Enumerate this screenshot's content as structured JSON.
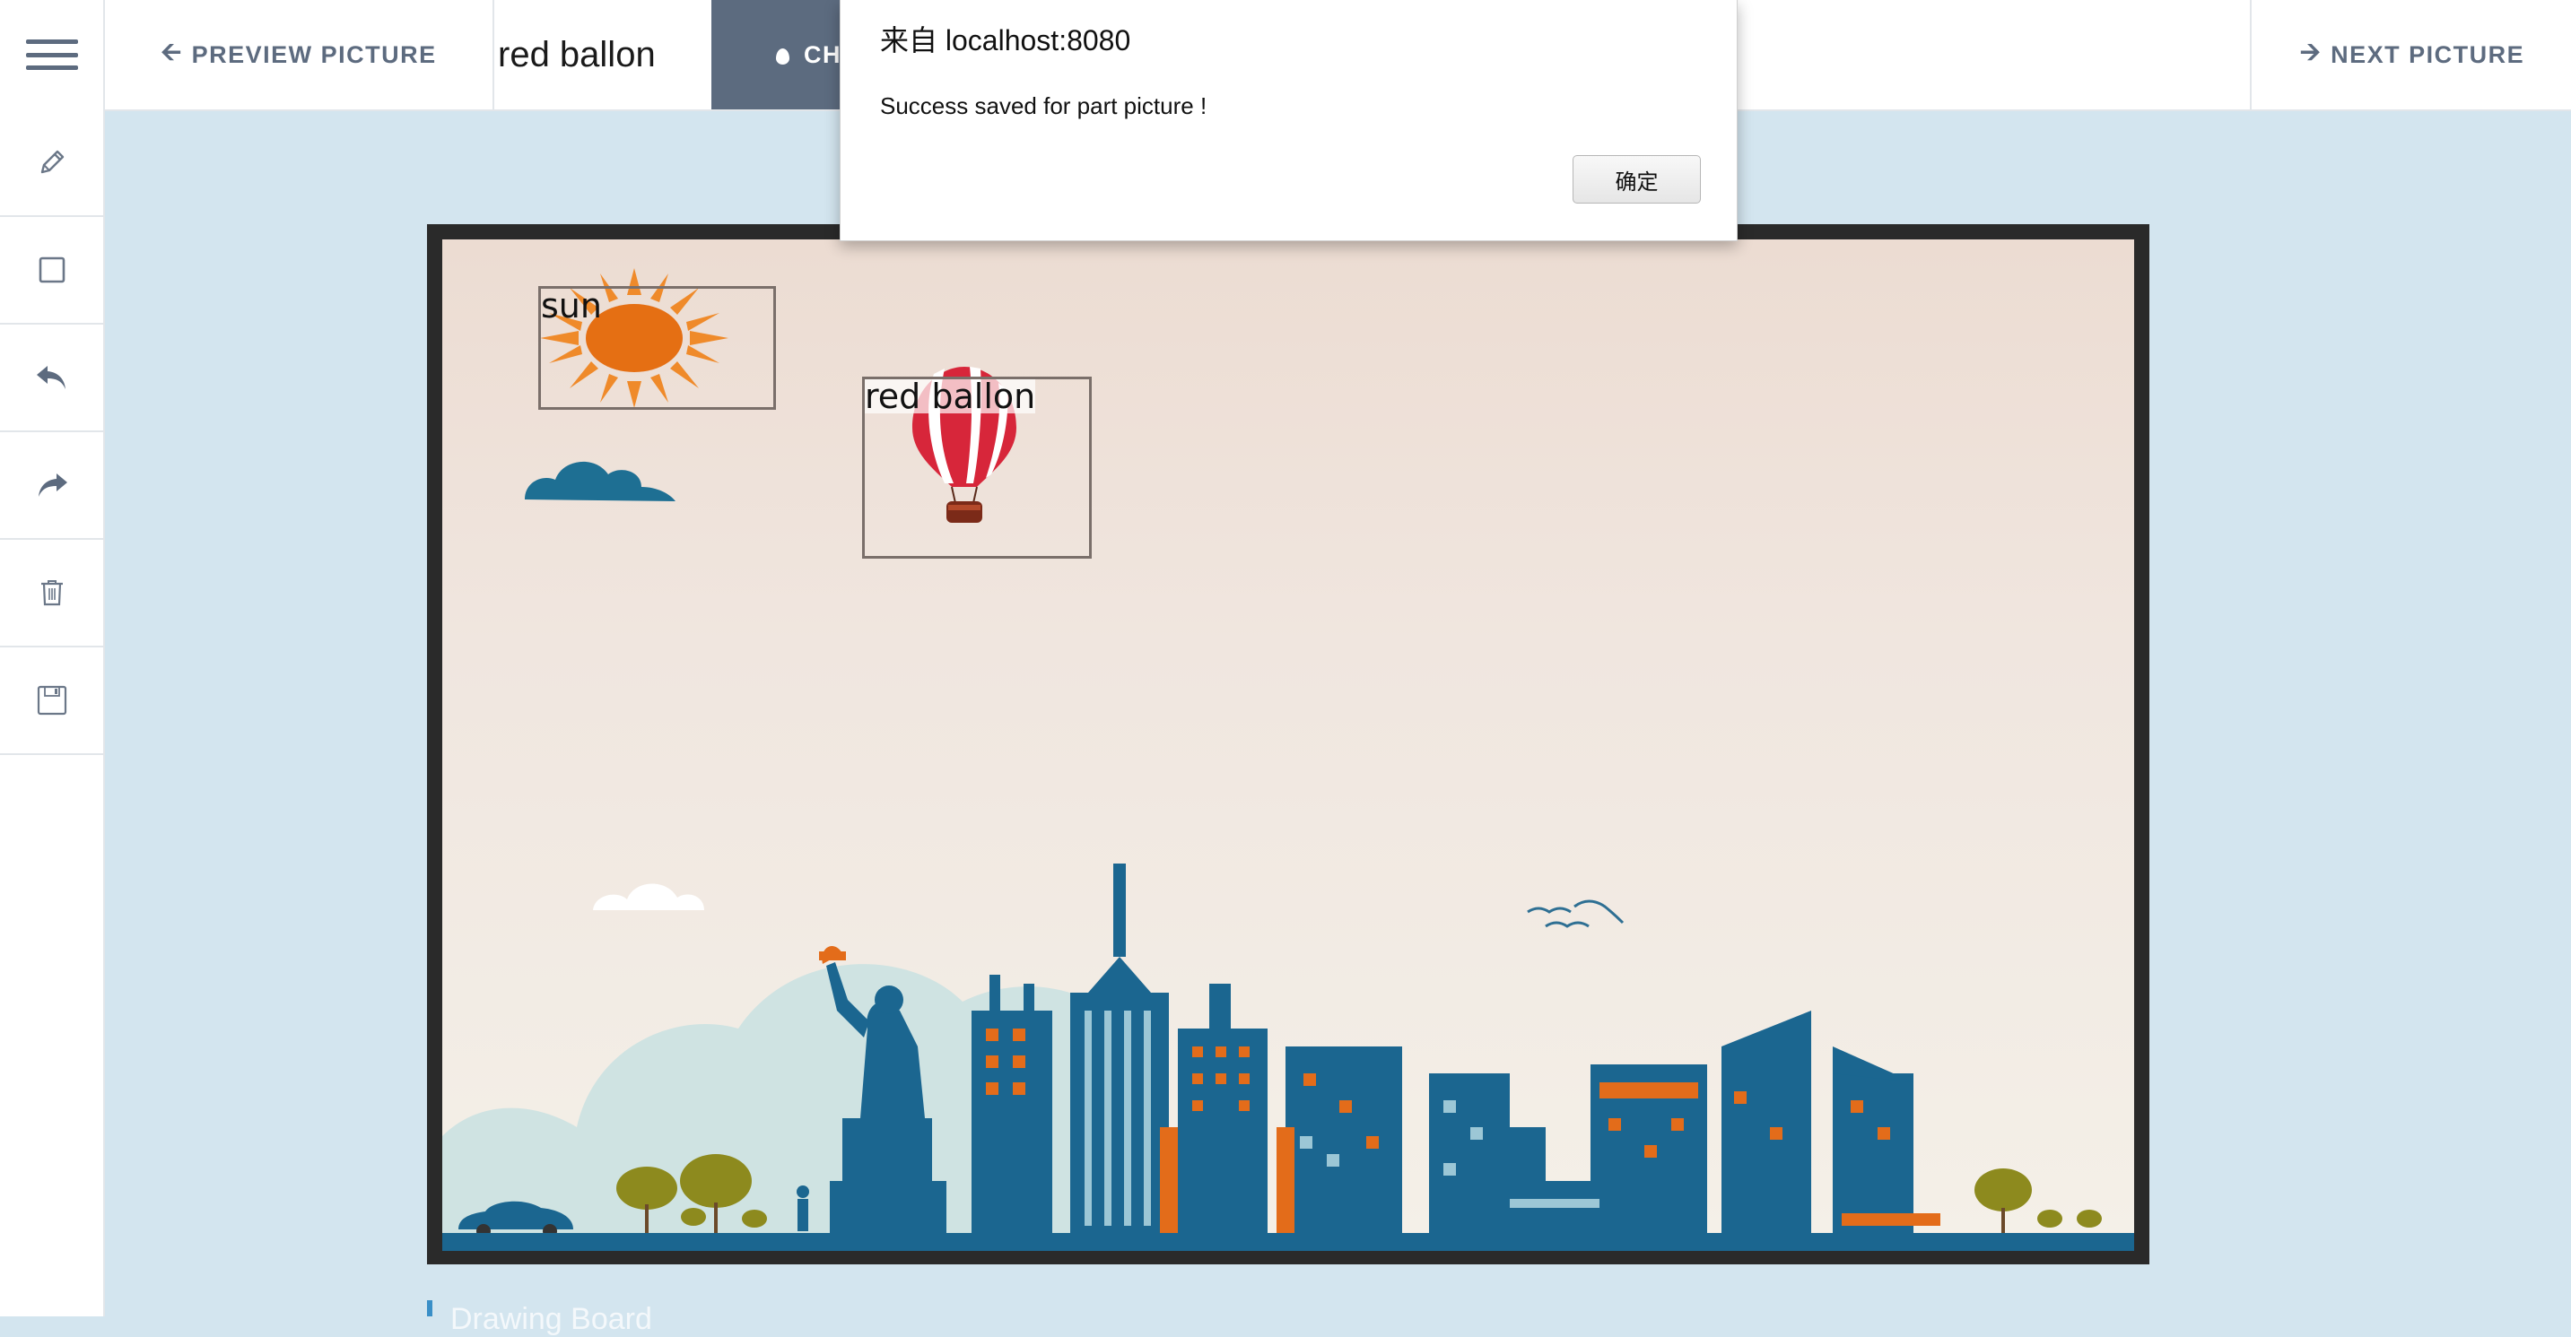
{
  "header": {
    "menu_icon": "hamburger-icon",
    "prev_label": "PREVIEW PICTURE",
    "prev_icon": "arrow-left-icon",
    "label_input_value": "red ballon",
    "change_label": "CH",
    "change_icon": "drop-icon",
    "next_label": "NEXT PICTURE",
    "next_icon": "arrow-right-icon"
  },
  "sidebar": {
    "tools": [
      {
        "name": "pencil",
        "icon": "pencil-icon"
      },
      {
        "name": "rectangle",
        "icon": "square-icon"
      },
      {
        "name": "undo",
        "icon": "undo-icon"
      },
      {
        "name": "redo",
        "icon": "redo-icon"
      },
      {
        "name": "delete",
        "icon": "trash-icon"
      },
      {
        "name": "save",
        "icon": "floppy-icon"
      }
    ]
  },
  "canvas": {
    "annotations": [
      {
        "label": "sun"
      },
      {
        "label": "red ballon"
      }
    ]
  },
  "below_canvas": {
    "title": "Drawing Board"
  },
  "dialog": {
    "title": "来自 localhost:8080",
    "message": "Success saved for part picture !",
    "ok_label": "确定"
  },
  "colors": {
    "toolbar_text": "#5d6b7f",
    "change_button_bg": "#5c6b7f",
    "page_bg": "#d3e5ef",
    "city_blue": "#1b6690",
    "accent_orange": "#e36c1a"
  }
}
